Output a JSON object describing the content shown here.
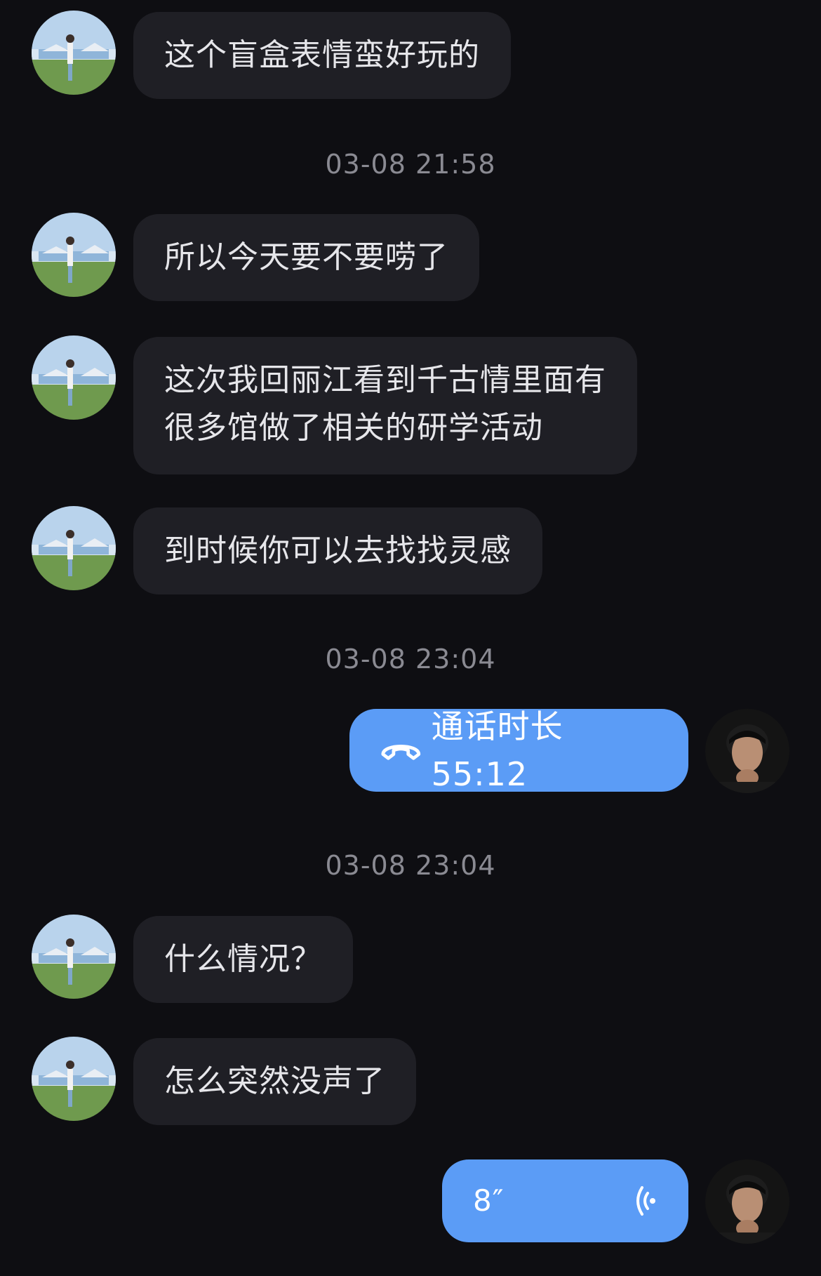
{
  "messages": [
    {
      "side": "left",
      "text": "这个盲盒表情蛮好玩的"
    },
    {
      "type": "timestamp",
      "text": "03-08 21:58"
    },
    {
      "side": "left",
      "text": "所以今天要不要唠了"
    },
    {
      "side": "left",
      "text": "这次我回丽江看到千古情里面有\n很多馆做了相关的研学活动"
    },
    {
      "side": "left",
      "text": "到时候你可以去找找灵感"
    },
    {
      "type": "timestamp",
      "text": "03-08 23:04"
    },
    {
      "side": "right",
      "kind": "call",
      "label": "通话时长 55:12",
      "icon": "phone-hangup-icon"
    },
    {
      "type": "timestamp",
      "text": "03-08 23:04"
    },
    {
      "side": "left",
      "text": "什么情况？"
    },
    {
      "side": "left",
      "text": "怎么突然没声了"
    },
    {
      "side": "right",
      "kind": "voice",
      "duration": "8″",
      "icon": "voice-wave-icon"
    }
  ],
  "colors": {
    "background": "#0e0e12",
    "incoming_bubble": "#1f1f25",
    "outgoing_bubble": "#5b9cf6",
    "timestamp_text": "#8a8a92"
  }
}
